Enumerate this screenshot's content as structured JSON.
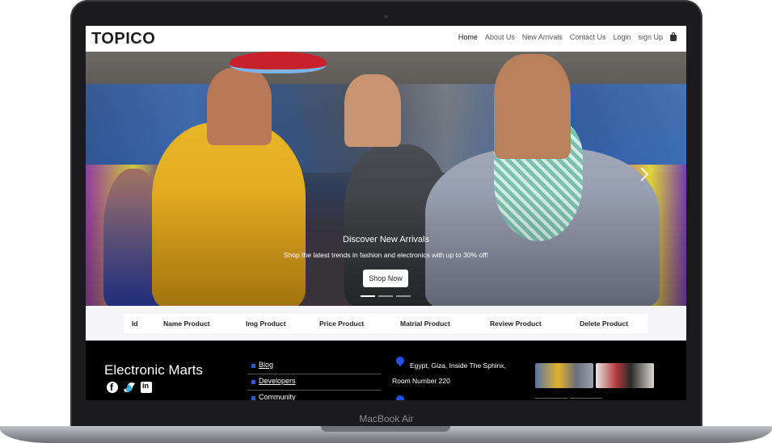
{
  "device": {
    "label": "MacBook Air"
  },
  "navbar": {
    "logo": "TOPICO",
    "links": [
      {
        "label": "Home",
        "active": true
      },
      {
        "label": "About Us",
        "active": false
      },
      {
        "label": "New Arrivals",
        "active": false
      },
      {
        "label": "Contact Us",
        "active": false
      },
      {
        "label": "Login",
        "active": false
      },
      {
        "label": "sign Up",
        "active": false
      }
    ],
    "cart_icon": "shopping-bag-icon"
  },
  "hero": {
    "title": "Discover New Arrivals",
    "subtitle": "Shop the latest trends in fashion and electronics with up to 30% off!",
    "button": "Shop Now",
    "slides_total": 3,
    "active_slide": 1
  },
  "table": {
    "headers": [
      "Id",
      "Name Product",
      "Img Product",
      "Price Product",
      "Matrial Product",
      "Review Product",
      "Delete Product"
    ]
  },
  "footer": {
    "brand": "Electronic Marts",
    "socials": [
      "facebook-icon",
      "twitter-icon",
      "linkedin-icon"
    ],
    "links": [
      "Blog",
      "Developers",
      "Community"
    ],
    "address_line1": "Egypt, Giza, Inside The Sphinx,",
    "address_line2": "Room Number 220"
  },
  "colors": {
    "accent": "#f2b40c",
    "footer_bg": "#000000",
    "footer_bullet": "#2f57d8",
    "pin": "#2052e6"
  }
}
